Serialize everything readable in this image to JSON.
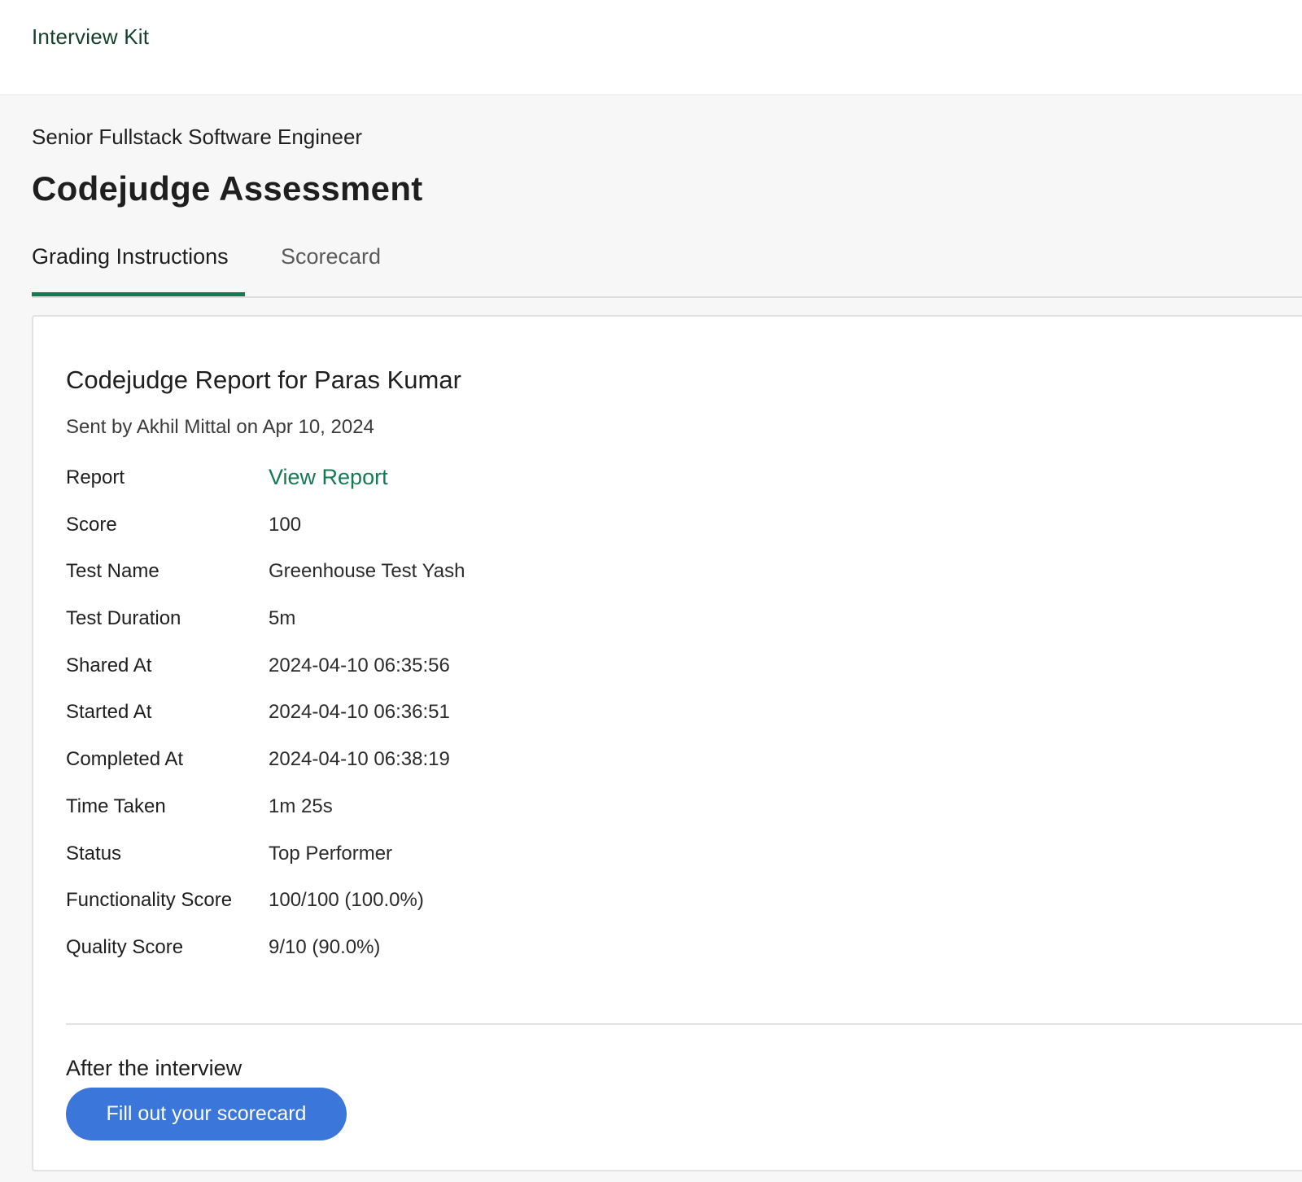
{
  "header": {
    "app_title": "Interview Kit"
  },
  "page": {
    "job_title": "Senior Fullstack Software Engineer",
    "title": "Codejudge Assessment"
  },
  "tabs": [
    {
      "label": "Grading Instructions",
      "active": true
    },
    {
      "label": "Scorecard",
      "active": false
    }
  ],
  "report": {
    "title": "Codejudge Report for Paras Kumar",
    "sent_by": "Sent by Akhil Mittal on Apr 10, 2024",
    "rows": [
      {
        "label": "Report",
        "value": "View Report",
        "is_link": true
      },
      {
        "label": "Score",
        "value": "100"
      },
      {
        "label": "Test Name",
        "value": "Greenhouse Test Yash"
      },
      {
        "label": "Test Duration",
        "value": "5m"
      },
      {
        "label": "Shared At",
        "value": "2024-04-10 06:35:56"
      },
      {
        "label": "Started At",
        "value": "2024-04-10 06:36:51"
      },
      {
        "label": "Completed At",
        "value": "2024-04-10 06:38:19"
      },
      {
        "label": "Time Taken",
        "value": "1m 25s"
      },
      {
        "label": "Status",
        "value": "Top Performer"
      },
      {
        "label": "Functionality Score",
        "value": "100/100 (100.0%)"
      },
      {
        "label": "Quality Score",
        "value": "9/10 (90.0%)"
      }
    ]
  },
  "after_interview": {
    "title": "After the interview",
    "button_label": "Fill out your scorecard"
  },
  "colors": {
    "accent_green": "#157a52",
    "button_blue": "#3b76db",
    "page_background": "#f7f7f7"
  }
}
